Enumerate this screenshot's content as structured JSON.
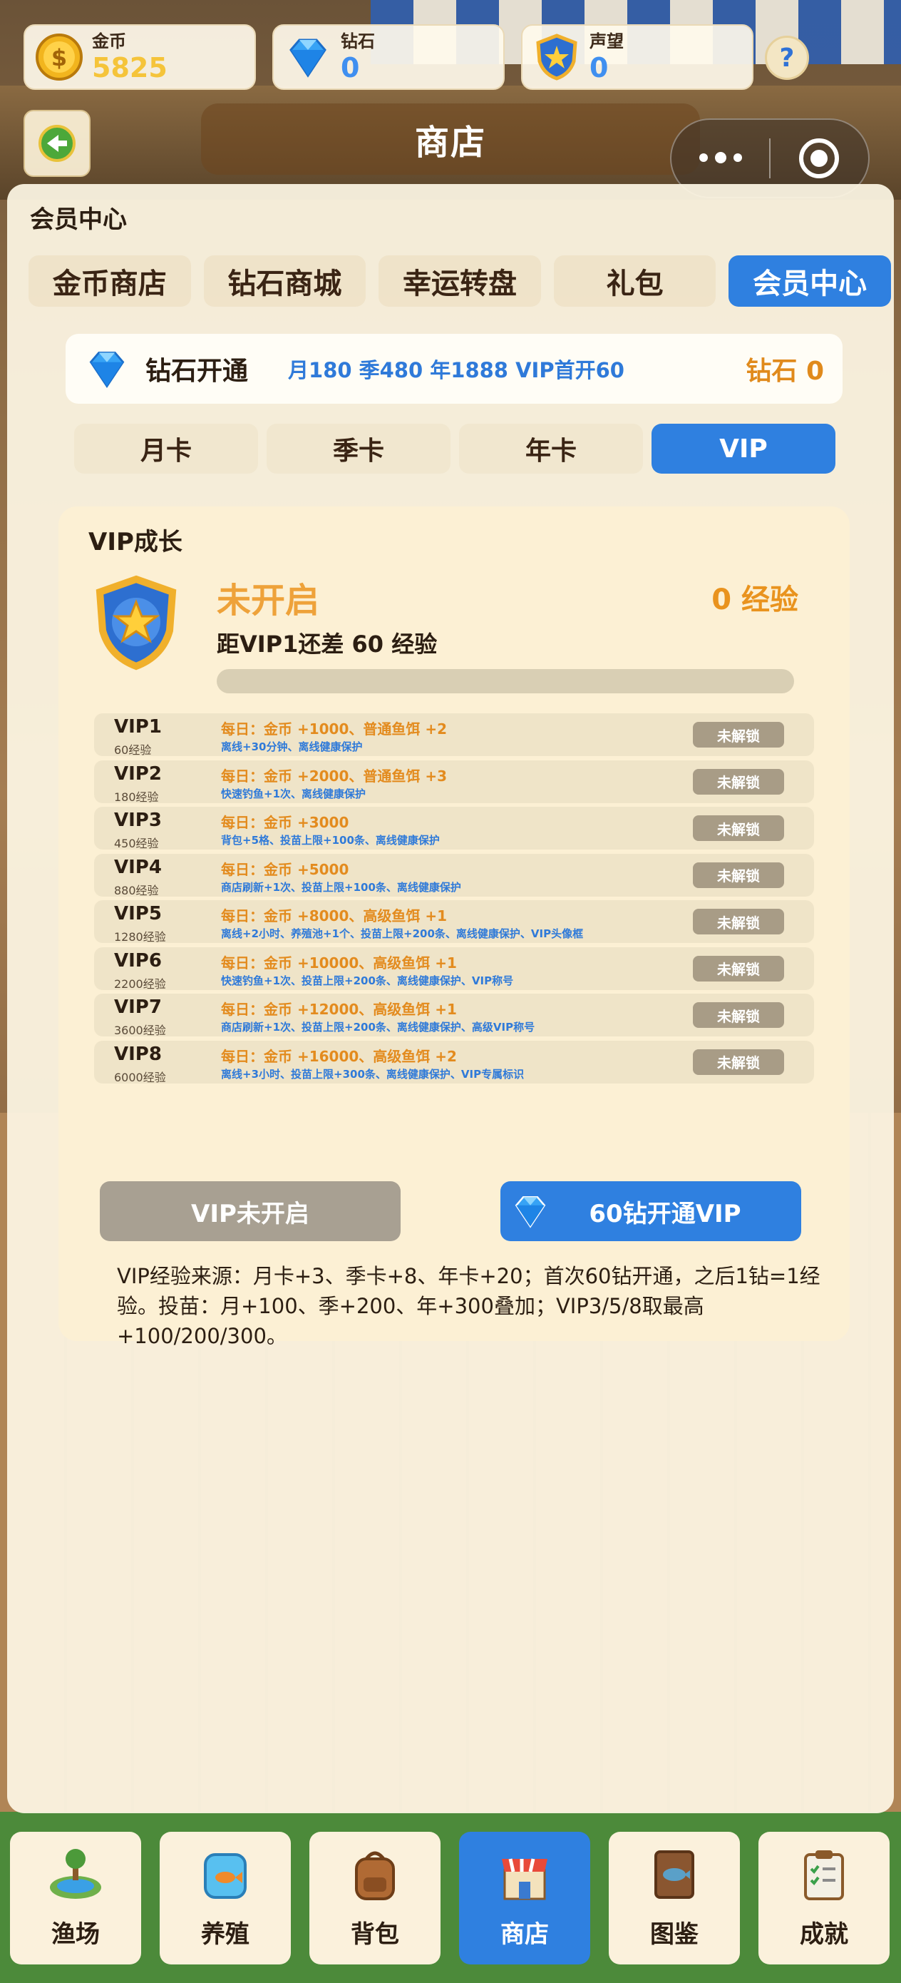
{
  "currencies": {
    "gold": {
      "label": "金币",
      "value": "5825",
      "color": "#f5c43a"
    },
    "diamond": {
      "label": "钻石",
      "value": "0",
      "color": "#3f8ff0"
    },
    "prestige": {
      "label": "声望",
      "value": "0",
      "color": "#3f8ff0"
    }
  },
  "help_label": "?",
  "header": {
    "title": "商店"
  },
  "section_label": "会员中心",
  "tabs": [
    {
      "label": "金币商店"
    },
    {
      "label": "钻石商城"
    },
    {
      "label": "幸运转盘"
    },
    {
      "label": "礼包"
    },
    {
      "label": "会员中心",
      "active": true
    }
  ],
  "diamond_unlock": {
    "title": "钻石开通",
    "prices": "月180 季480 年1888 VIP首开60",
    "balance": "钻石 0"
  },
  "subtabs": [
    {
      "label": "月卡"
    },
    {
      "label": "季卡"
    },
    {
      "label": "年卡"
    },
    {
      "label": "VIP",
      "active": true
    }
  ],
  "vip": {
    "heading": "VIP成长",
    "status": "未开启",
    "exp": "0 经验",
    "gap_text": "距VIP1还差 60 经验",
    "progress": 0,
    "levels": [
      {
        "name": "VIP1",
        "req": "60经验",
        "daily": "每日：金币 +1000、普通鱼饵 +2",
        "extra": "离线+30分钟、离线健康保护",
        "lock": "未解锁"
      },
      {
        "name": "VIP2",
        "req": "180经验",
        "daily": "每日：金币 +2000、普通鱼饵 +3",
        "extra": "快速钓鱼+1次、离线健康保护",
        "lock": "未解锁"
      },
      {
        "name": "VIP3",
        "req": "450经验",
        "daily": "每日：金币 +3000",
        "extra": "背包+5格、投苗上限+100条、离线健康保护",
        "lock": "未解锁"
      },
      {
        "name": "VIP4",
        "req": "880经验",
        "daily": "每日：金币 +5000",
        "extra": "商店刷新+1次、投苗上限+100条、离线健康保护",
        "lock": "未解锁"
      },
      {
        "name": "VIP5",
        "req": "1280经验",
        "daily": "每日：金币 +8000、高级鱼饵 +1",
        "extra": "离线+2小时、养殖池+1个、投苗上限+200条、离线健康保护、VIP头像框",
        "lock": "未解锁"
      },
      {
        "name": "VIP6",
        "req": "2200经验",
        "daily": "每日：金币 +10000、高级鱼饵 +1",
        "extra": "快速钓鱼+1次、投苗上限+200条、离线健康保护、VIP称号",
        "lock": "未解锁"
      },
      {
        "name": "VIP7",
        "req": "3600经验",
        "daily": "每日：金币 +12000、高级鱼饵 +1",
        "extra": "商店刷新+1次、投苗上限+200条、离线健康保护、高级VIP称号",
        "lock": "未解锁"
      },
      {
        "name": "VIP8",
        "req": "6000经验",
        "daily": "每日：金币 +16000、高级鱼饵 +2",
        "extra": "离线+3小时、投苗上限+300条、离线健康保护、VIP专属标识",
        "lock": "未解锁"
      }
    ],
    "note": "VIP经验来源：月卡+3、季卡+8、年卡+20；首次60钻开通，之后1钻=1经验。投苗：月+100、季+200、年+300叠加；VIP3/5/8取最高+100/200/300。"
  },
  "actions": {
    "disabled": "VIP未开启",
    "buy": "60钻开通VIP"
  },
  "bottom_nav": [
    {
      "label": "渔场",
      "icon": "pond-icon"
    },
    {
      "label": "养殖",
      "icon": "fish-tank-icon"
    },
    {
      "label": "背包",
      "icon": "backpack-icon"
    },
    {
      "label": "商店",
      "icon": "shop-icon",
      "active": true
    },
    {
      "label": "图鉴",
      "icon": "book-icon"
    },
    {
      "label": "成就",
      "icon": "clipboard-icon"
    }
  ]
}
